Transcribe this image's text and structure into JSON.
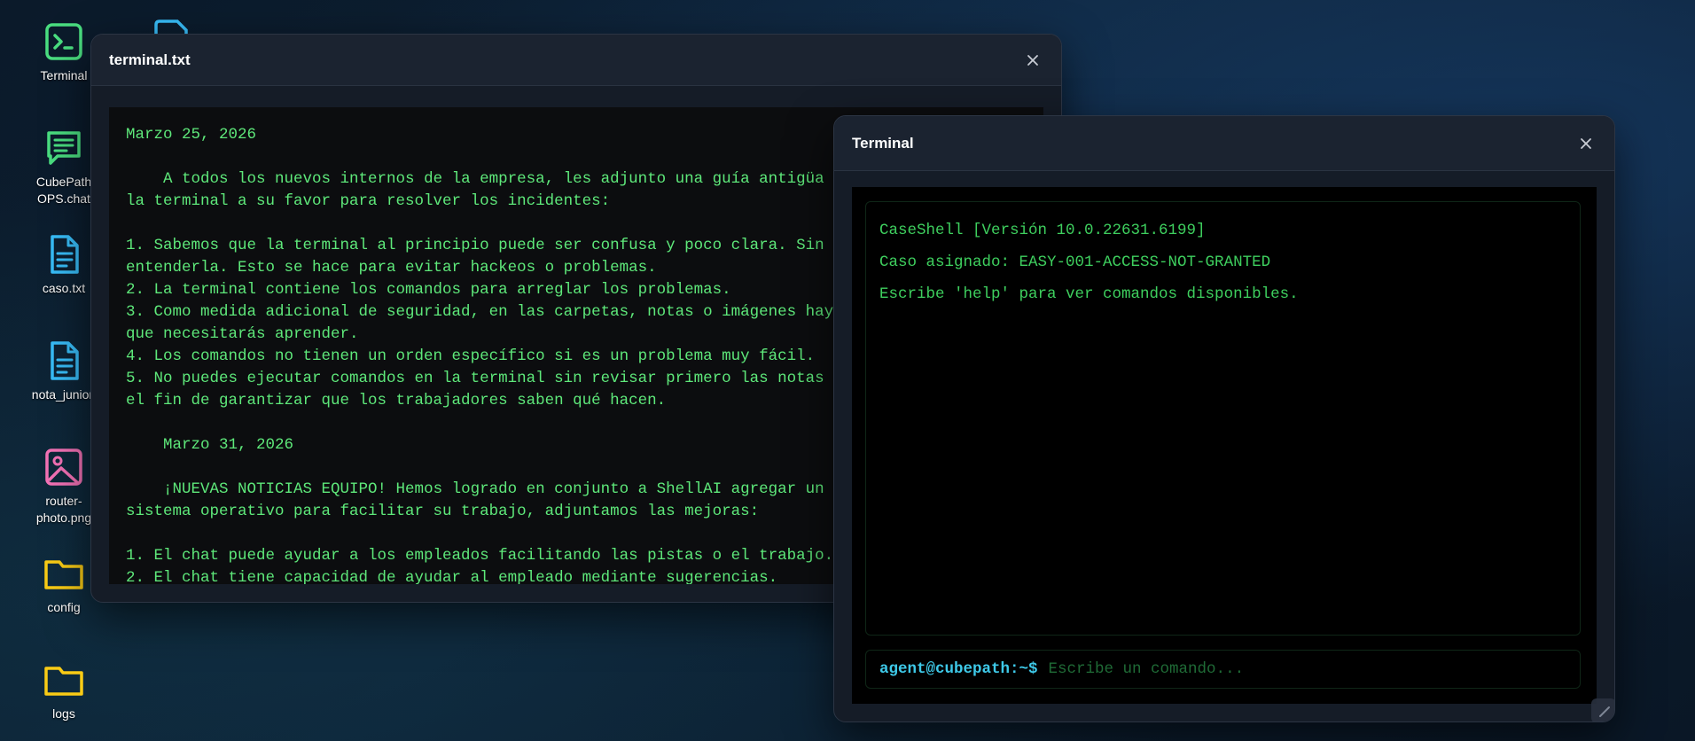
{
  "desktop": {
    "icons": [
      {
        "label": "Terminal",
        "icon": "terminal-icon",
        "color": "#4ade80"
      },
      {
        "label": "CubePath OPS.chat",
        "icon": "chat-icon",
        "color": "#4ade80"
      },
      {
        "label": "caso.txt",
        "icon": "document-icon",
        "color": "#38bdf8"
      },
      {
        "label": "nota_junior.",
        "icon": "document-icon",
        "color": "#38bdf8"
      },
      {
        "label": "router-photo.png",
        "icon": "image-icon",
        "color": "#f472b6"
      },
      {
        "label": "config",
        "icon": "folder-icon",
        "color": "#facc15"
      },
      {
        "label": "logs",
        "icon": "folder-icon",
        "color": "#facc15"
      }
    ]
  },
  "notes_window": {
    "title": "terminal.txt",
    "content": "Marzo 25, 2026\n\n    A todos los nuevos internos de la empresa, les adjunto una guía antigüa\nla terminal a su favor para resolver los incidentes:\n\n1. Sabemos que la terminal al principio puede ser confusa y poco clara. Sin\nentenderla. Esto se hace para evitar hackeos o problemas.\n2. La terminal contiene los comandos para arreglar los problemas.\n3. Como medida adicional de seguridad, en las carpetas, notas o imágenes hay\nque necesitarás aprender.\n4. Los comandos no tienen un orden específico si es un problema muy fácil.\n5. No puedes ejecutar comandos en la terminal sin revisar primero las notas\nel fin de garantizar que los trabajadores saben qué hacen.\n\n    Marzo 31, 2026\n\n    ¡NUEVAS NOTICIAS EQUIPO! Hemos logrado en conjunto a ShellAI agregar un\nsistema operativo para facilitar su trabajo, adjuntamos las mejoras:\n\n1. El chat puede ayudar a los empleados facilitando las pistas o el trabajo.\n2. El chat tiene capacidad de ayudar al empleado mediante sugerencias."
  },
  "terminal_window": {
    "title": "Terminal",
    "output": [
      "CaseShell [Versión 10.0.22631.6199]",
      "Caso asignado: EASY-001-ACCESS-NOT-GRANTED",
      "Escribe 'help' para ver comandos disponibles."
    ],
    "prompt": "agent@cubepath:~$",
    "input_value": "",
    "input_placeholder": "Escribe un comando..."
  },
  "colors": {
    "text_green": "#5ee87a",
    "prompt_cyan": "#3ec9e8",
    "window_bg": "#151c27"
  }
}
